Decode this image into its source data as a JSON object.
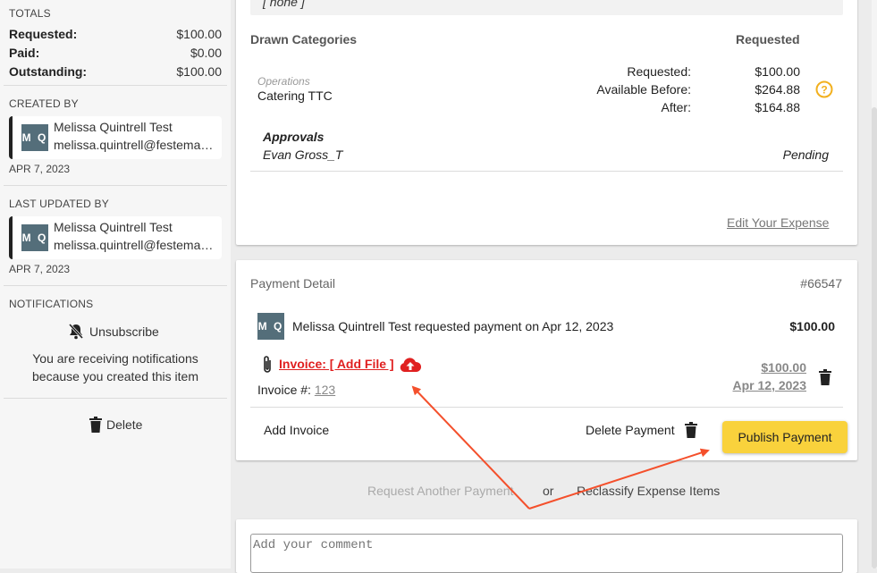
{
  "sidebar": {
    "totals_title": "TOTALS",
    "totals": [
      {
        "label": "Requested:",
        "value": "$100.00"
      },
      {
        "label": "Paid:",
        "value": "$0.00"
      },
      {
        "label": "Outstanding:",
        "value": "$100.00"
      }
    ],
    "created_by_title": "CREATED BY",
    "created_by": {
      "initials": "M Q",
      "name": "Melissa Quintrell Test",
      "email": "melissa.quintrell@festemail.com",
      "date": "APR 7, 2023"
    },
    "last_updated_title": "LAST UPDATED BY",
    "last_updated_by": {
      "initials": "M Q",
      "name": "Melissa Quintrell Test",
      "email": "melissa.quintrell@festemail.com",
      "date": "APR 7, 2023"
    },
    "notifications_title": "NOTIFICATIONS",
    "unsubscribe_label": "Unsubscribe",
    "notification_text_1": "You are receiving notifications",
    "notification_text_2": "because you created this item",
    "delete_label": "Delete"
  },
  "expense": {
    "none_text": "[ none ]",
    "drawn_categories_label": "Drawn Categories",
    "requested_header": "Requested",
    "category_group": "Operations",
    "category_name": "Catering TTC",
    "requested_label": "Requested:",
    "requested_value": "$100.00",
    "available_before_label": "Available Before:",
    "available_before_value": "$264.88",
    "after_label": "After:",
    "after_value": "$164.88",
    "approvals_label": "Approvals",
    "approver": "Evan Gross_T",
    "approval_status": "Pending",
    "edit_link": "Edit Your Expense"
  },
  "payment": {
    "title": "Payment Detail",
    "id": "#66547",
    "initials": "M Q",
    "request_text": "Melissa Quintrell Test requested payment on Apr 12, 2023",
    "amount": "$100.00",
    "invoice_link": "Invoice: [ Add File ]",
    "invoice_number_label": "Invoice #:",
    "invoice_number": "123",
    "line_amount": "$100.00",
    "line_date": "Apr 12, 2023",
    "add_invoice": "Add Invoice",
    "delete_payment": "Delete Payment",
    "publish_payment": "Publish Payment"
  },
  "actions": {
    "request_another": "Request Another Payment",
    "or": "or",
    "reclassify": "Reclassify Expense Items"
  },
  "comment": {
    "placeholder": "Add your comment"
  },
  "colors": {
    "accent": "#f9d23c",
    "annotation_arrow": "#f4502c",
    "invoice_link": "#e02020",
    "help_icon": "#f2b01e"
  }
}
